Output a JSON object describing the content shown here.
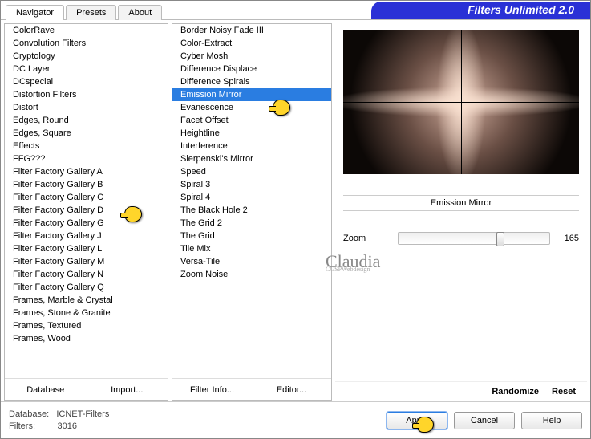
{
  "banner": "Filters Unlimited 2.0",
  "tabs": [
    "Navigator",
    "Presets",
    "About"
  ],
  "active_tab": 0,
  "categories": [
    "ColorRave",
    "Convolution Filters",
    "Cryptology",
    "DC Layer",
    "DCspecial",
    "Distortion Filters",
    "Distort",
    "Edges, Round",
    "Edges, Square",
    "Effects",
    "FFG???",
    "Filter Factory Gallery A",
    "Filter Factory Gallery B",
    "Filter Factory Gallery C",
    "Filter Factory Gallery D",
    "Filter Factory Gallery G",
    "Filter Factory Gallery J",
    "Filter Factory Gallery L",
    "Filter Factory Gallery M",
    "Filter Factory Gallery N",
    "Filter Factory Gallery Q",
    "Frames, Marble & Crystal",
    "Frames, Stone & Granite",
    "Frames, Textured",
    "Frames, Wood"
  ],
  "category_sel": 13,
  "filters": [
    "Border Noisy Fade III",
    "Color-Extract",
    "Cyber Mosh",
    "Difference Displace",
    "Difference Spirals",
    "Emission Mirror",
    "Evanescence",
    "Facet Offset",
    "Heightline",
    "Interference",
    "Sierpenski's Mirror",
    "Speed",
    "Spiral 3",
    "Spiral 4",
    "The Black Hole 2",
    "The Grid 2",
    "The Grid",
    "Tile Mix",
    "Versa-Tile",
    "Zoom Noise"
  ],
  "filter_sel": 5,
  "category_buttons": [
    "Database",
    "Import..."
  ],
  "filter_buttons": [
    "Filter Info...",
    "Editor..."
  ],
  "current_filter": "Emission Mirror",
  "params": [
    {
      "label": "Zoom",
      "value": 165,
      "pct": 65
    }
  ],
  "right_buttons": [
    "Randomize",
    "Reset"
  ],
  "status": {
    "db_label": "Database:",
    "db_value": "ICNET-Filters",
    "f_label": "Filters:",
    "f_value": "3016"
  },
  "action_buttons": [
    "Apply",
    "Cancel",
    "Help"
  ],
  "watermark": {
    "a": "Claudia",
    "b": "CGSPWebdesign"
  }
}
